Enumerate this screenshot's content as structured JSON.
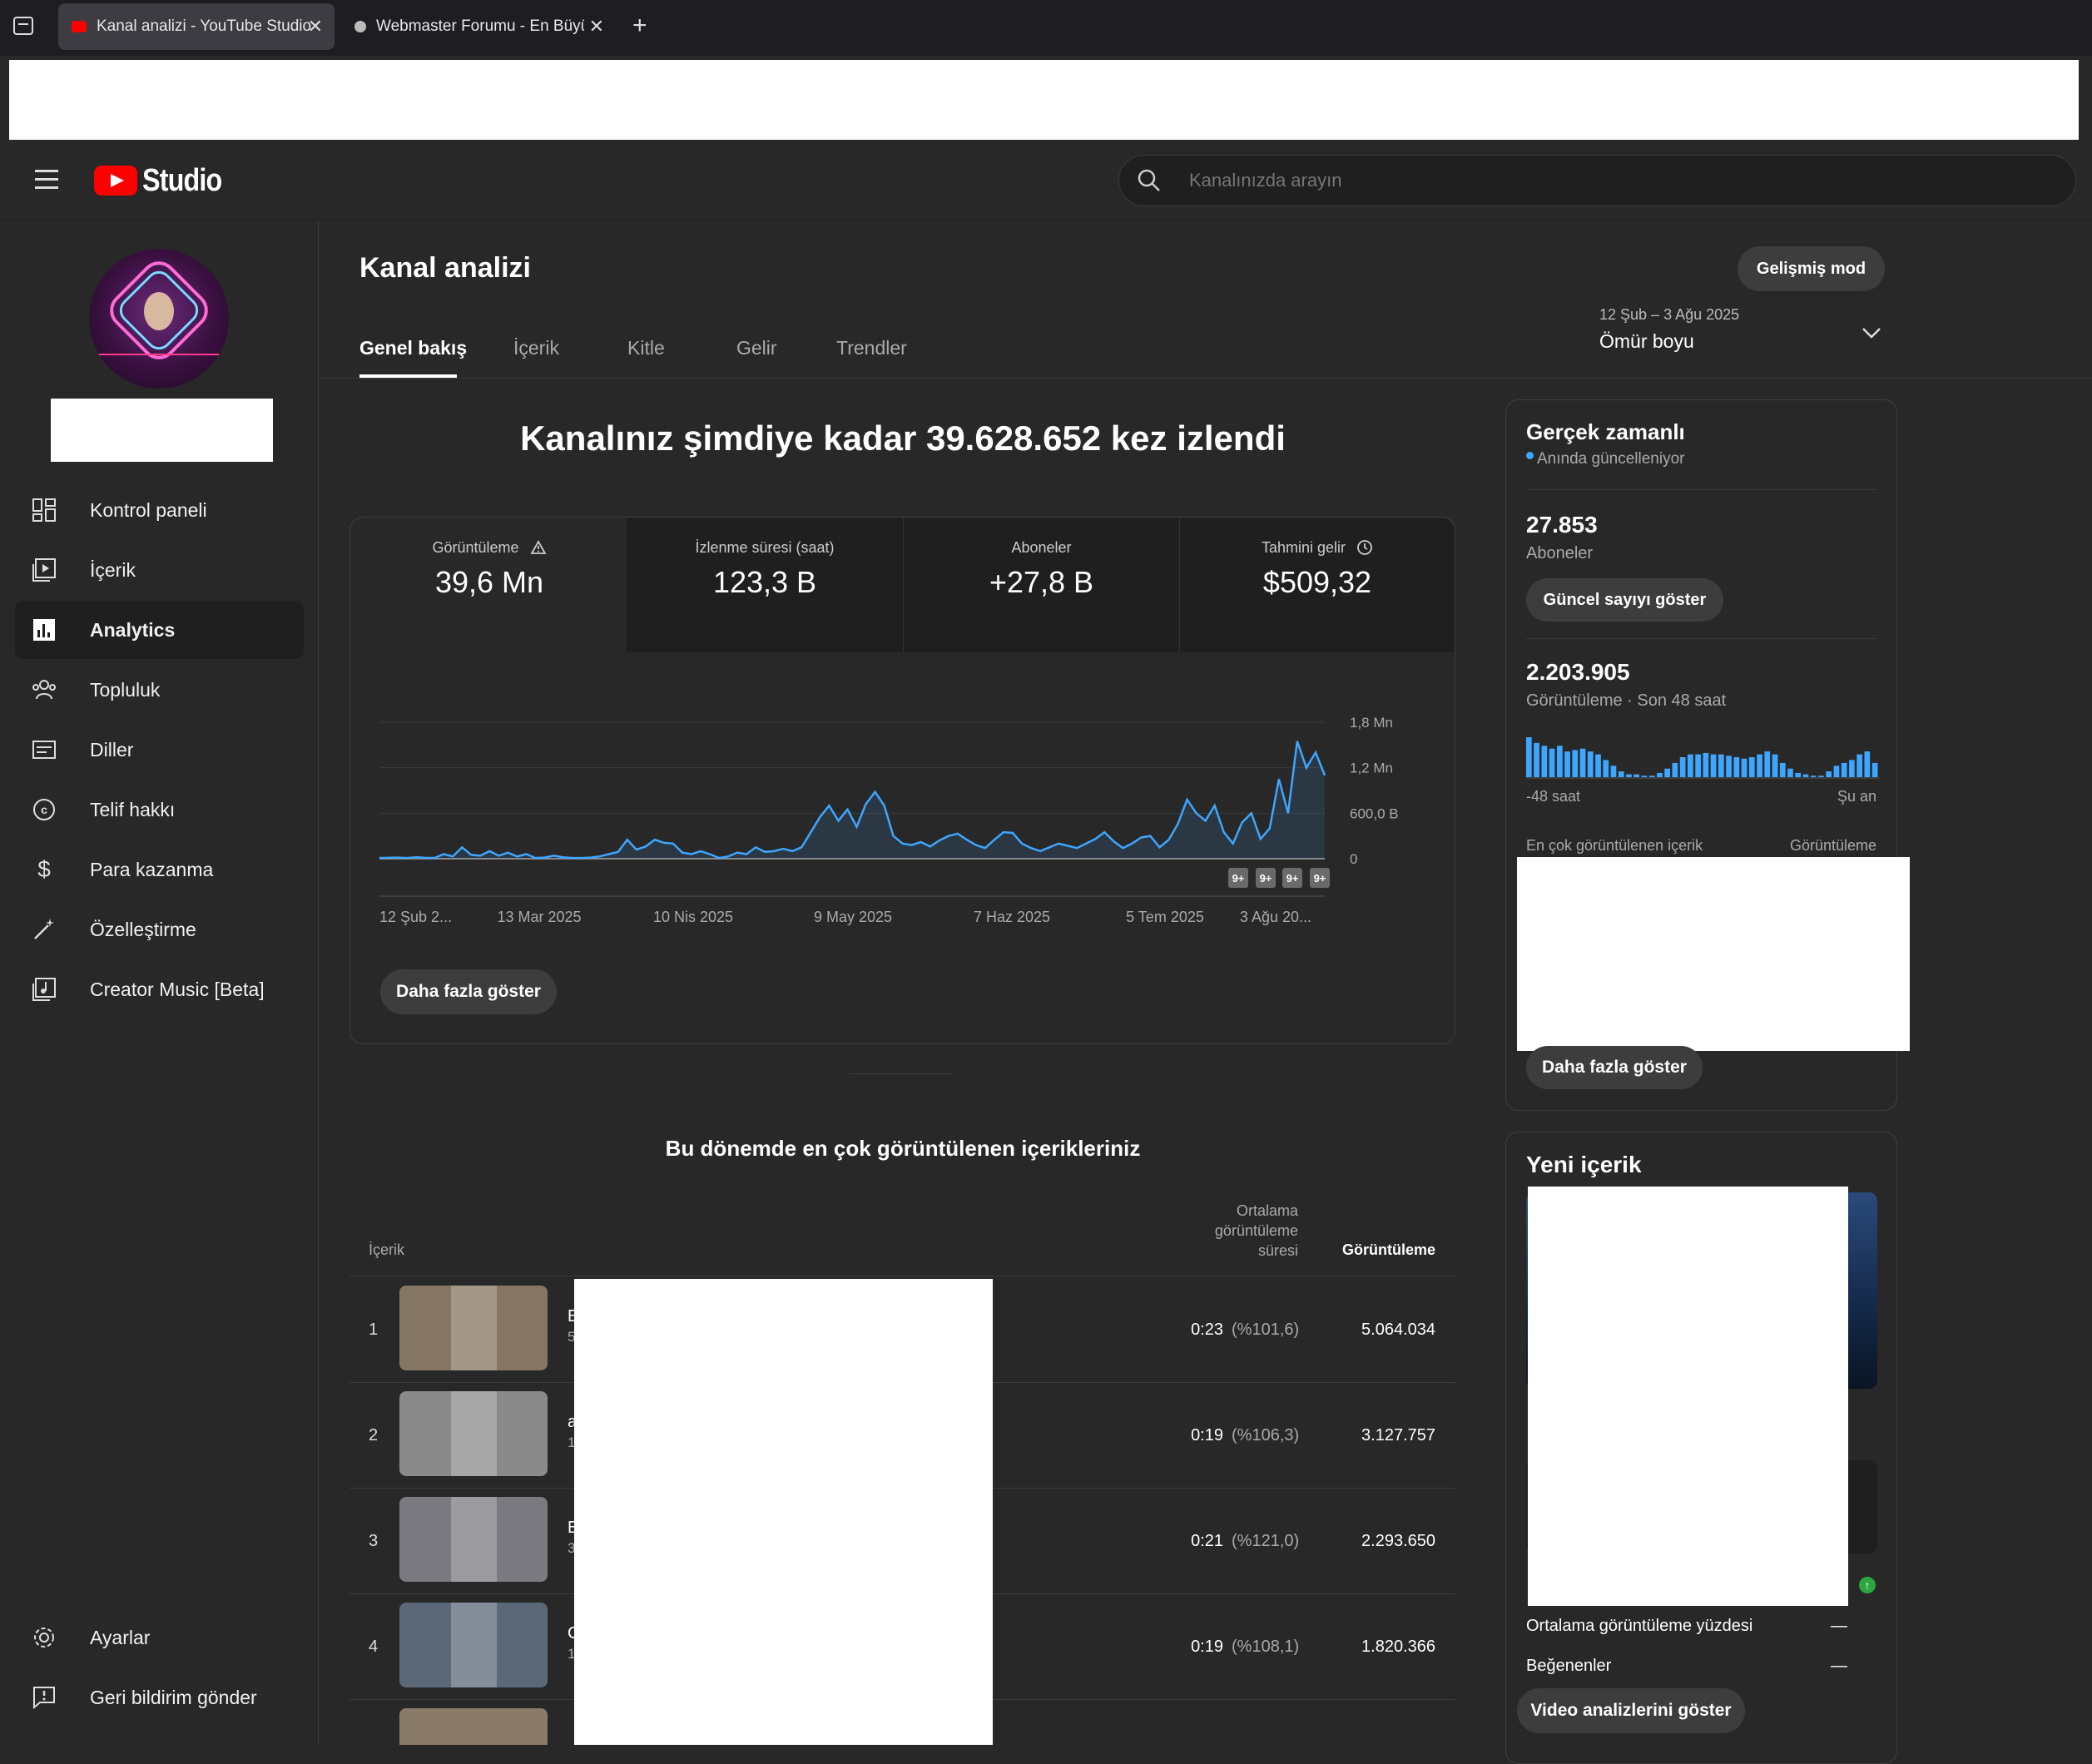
{
  "browser": {
    "tabs": [
      {
        "title": "Kanal analizi - YouTube Studio",
        "close": "✕"
      },
      {
        "title": "Webmaster Forumu - En Büyük",
        "close": "✕"
      }
    ],
    "new_tab": "+"
  },
  "header": {
    "logo_text": "Studio",
    "search_placeholder": "Kanalınızda arayın"
  },
  "sidebar": {
    "items": [
      {
        "label": "Kontrol paneli",
        "icon": "dashboard-icon"
      },
      {
        "label": "İçerik",
        "icon": "content-icon"
      },
      {
        "label": "Analytics",
        "icon": "analytics-icon",
        "active": true
      },
      {
        "label": "Topluluk",
        "icon": "community-icon"
      },
      {
        "label": "Diller",
        "icon": "subtitles-icon"
      },
      {
        "label": "Telif hakkı",
        "icon": "copyright-icon"
      },
      {
        "label": "Para kazanma",
        "icon": "dollar-icon"
      },
      {
        "label": "Özelleştirme",
        "icon": "magic-wand-icon"
      },
      {
        "label": "Creator Music [Beta]",
        "icon": "music-icon"
      }
    ],
    "settings": "Ayarlar",
    "feedback": "Geri bildirim gönder"
  },
  "page": {
    "title": "Kanal analizi",
    "advanced_mode": "Gelişmiş mod",
    "tabs": [
      "Genel bakış",
      "İçerik",
      "Kitle",
      "Gelir",
      "Trendler"
    ],
    "date_range": "12 Şub – 3 Ağu 2025",
    "date_label": "Ömür boyu"
  },
  "overview": {
    "headline": "Kanalınız şimdiye kadar 39.628.652 kez izlendi",
    "metrics": [
      {
        "title": "Görüntüleme",
        "value": "39,6 Mn",
        "icon": "warning-icon"
      },
      {
        "title": "İzlenme süresi (saat)",
        "value": "123,3 B"
      },
      {
        "title": "Aboneler",
        "value": "+27,8 B"
      },
      {
        "title": "Tahmini gelir",
        "value": "$509,32",
        "icon": "clock-icon"
      }
    ],
    "show_more": "Daha fazla göster",
    "badge": "9+"
  },
  "chart_data": {
    "type": "area",
    "y_ticks": [
      "1,8 Mn",
      "1,2 Mn",
      "600,0 B",
      "0"
    ],
    "ylim": [
      0,
      1800000
    ],
    "x_ticks": [
      "12 Şub 2...",
      "13 Mar 2025",
      "10 Nis 2025",
      "9 May 2025",
      "7 Haz 2025",
      "5 Tem 2025",
      "3 Ağu 20..."
    ],
    "color": "#3ea6ff",
    "values": [
      10000,
      12000,
      15000,
      10000,
      20000,
      12000,
      10000,
      60000,
      30000,
      150000,
      50000,
      40000,
      100000,
      40000,
      80000,
      30000,
      60000,
      10000,
      15000,
      40000,
      20000,
      10000,
      10000,
      15000,
      30000,
      60000,
      90000,
      250000,
      120000,
      160000,
      250000,
      210000,
      200000,
      80000,
      60000,
      100000,
      60000,
      10000,
      30000,
      80000,
      60000,
      150000,
      90000,
      100000,
      130000,
      100000,
      150000,
      350000,
      550000,
      700000,
      500000,
      650000,
      420000,
      720000,
      880000,
      700000,
      300000,
      200000,
      180000,
      220000,
      160000,
      240000,
      300000,
      330000,
      250000,
      180000,
      140000,
      250000,
      350000,
      340000,
      200000,
      140000,
      100000,
      150000,
      200000,
      170000,
      140000,
      200000,
      260000,
      350000,
      230000,
      140000,
      200000,
      280000,
      300000,
      150000,
      250000,
      460000,
      780000,
      600000,
      500000,
      700000,
      350000,
      200000,
      480000,
      600000,
      260000,
      400000,
      1050000,
      600000,
      1550000,
      1200000,
      1400000,
      1100000
    ]
  },
  "top_content": {
    "title": "Bu dönemde en çok görüntülenen içerikleriniz",
    "col_content": "İçerik",
    "col_avg": "Ortalama görüntüleme süresi",
    "col_views": "Görüntüleme",
    "rows": [
      {
        "rank": "1",
        "letter": "E",
        "sub": "5",
        "avg": "0:23",
        "pct": "(%101,6)",
        "views": "5.064.034",
        "thumb": "#857563"
      },
      {
        "rank": "2",
        "letter": "a",
        "sub": "1",
        "avg": "0:19",
        "pct": "(%106,3)",
        "views": "3.127.757",
        "thumb": "#8a8a8a"
      },
      {
        "rank": "3",
        "letter": "E",
        "sub": "3",
        "avg": "0:21",
        "pct": "(%121,0)",
        "views": "2.293.650",
        "thumb": "#7a7a80"
      },
      {
        "rank": "4",
        "letter": "C",
        "sub": "1",
        "avg": "0:19",
        "pct": "(%108,1)",
        "views": "1.820.366",
        "thumb": "#5a6878"
      }
    ]
  },
  "realtime": {
    "title": "Gerçek zamanlı",
    "subtitle": "Anında güncelleniyor",
    "subs_value": "27.853",
    "subs_label": "Aboneler",
    "show_count": "Güncel sayıyı göster",
    "views_value": "2.203.905",
    "views_label": "Görüntüleme · Son 48 saat",
    "axis_left": "-48 saat",
    "axis_right": "Şu an",
    "top_label": "En çok görüntülenen içerik",
    "top_col": "Görüntüleme",
    "show_more": "Daha fazla göster",
    "bars": [
      28,
      24,
      22,
      20,
      22,
      18,
      19,
      20,
      18,
      16,
      12,
      8,
      4,
      2,
      2,
      1,
      1,
      3,
      6,
      10,
      14,
      16,
      16,
      17,
      16,
      16,
      15,
      14,
      13,
      14,
      16,
      18,
      16,
      10,
      6,
      3,
      2,
      1,
      1,
      4,
      8,
      10,
      12,
      16,
      18,
      10
    ]
  },
  "new_content": {
    "title": "Yeni içerik",
    "stat1": "Ortalama görüntüleme yüzdesi",
    "stat1_value": "—",
    "stat2": "Beğenenler",
    "stat2_value": "—",
    "button": "Video analizlerini göster"
  }
}
